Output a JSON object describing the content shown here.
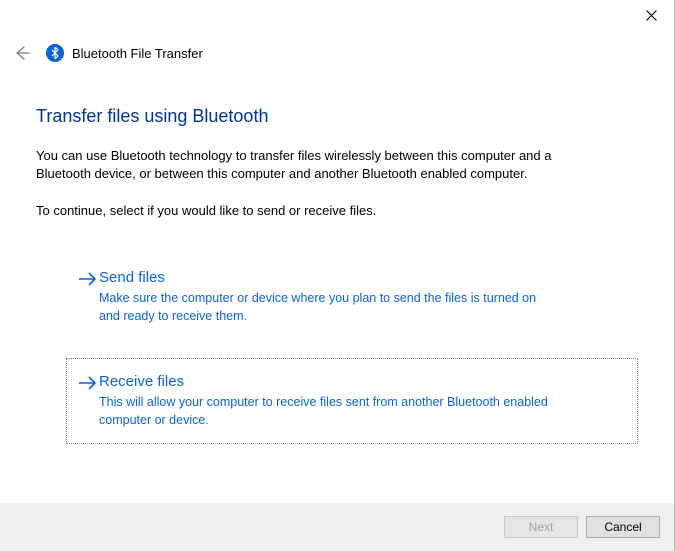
{
  "window": {
    "title": "Bluetooth File Transfer"
  },
  "page": {
    "heading": "Transfer files using Bluetooth",
    "description1": "You can use Bluetooth technology to transfer files wirelessly between this computer and a Bluetooth device, or between this computer and another Bluetooth enabled computer.",
    "description2": "To continue, select if you would like to send or receive files."
  },
  "options": {
    "send": {
      "title": "Send files",
      "desc": "Make sure the computer or device where you plan to send the files is turned on and ready to receive them."
    },
    "receive": {
      "title": "Receive files",
      "desc": "This will allow your computer to receive files sent from another Bluetooth enabled computer or device."
    }
  },
  "footer": {
    "next": "Next",
    "cancel": "Cancel"
  }
}
